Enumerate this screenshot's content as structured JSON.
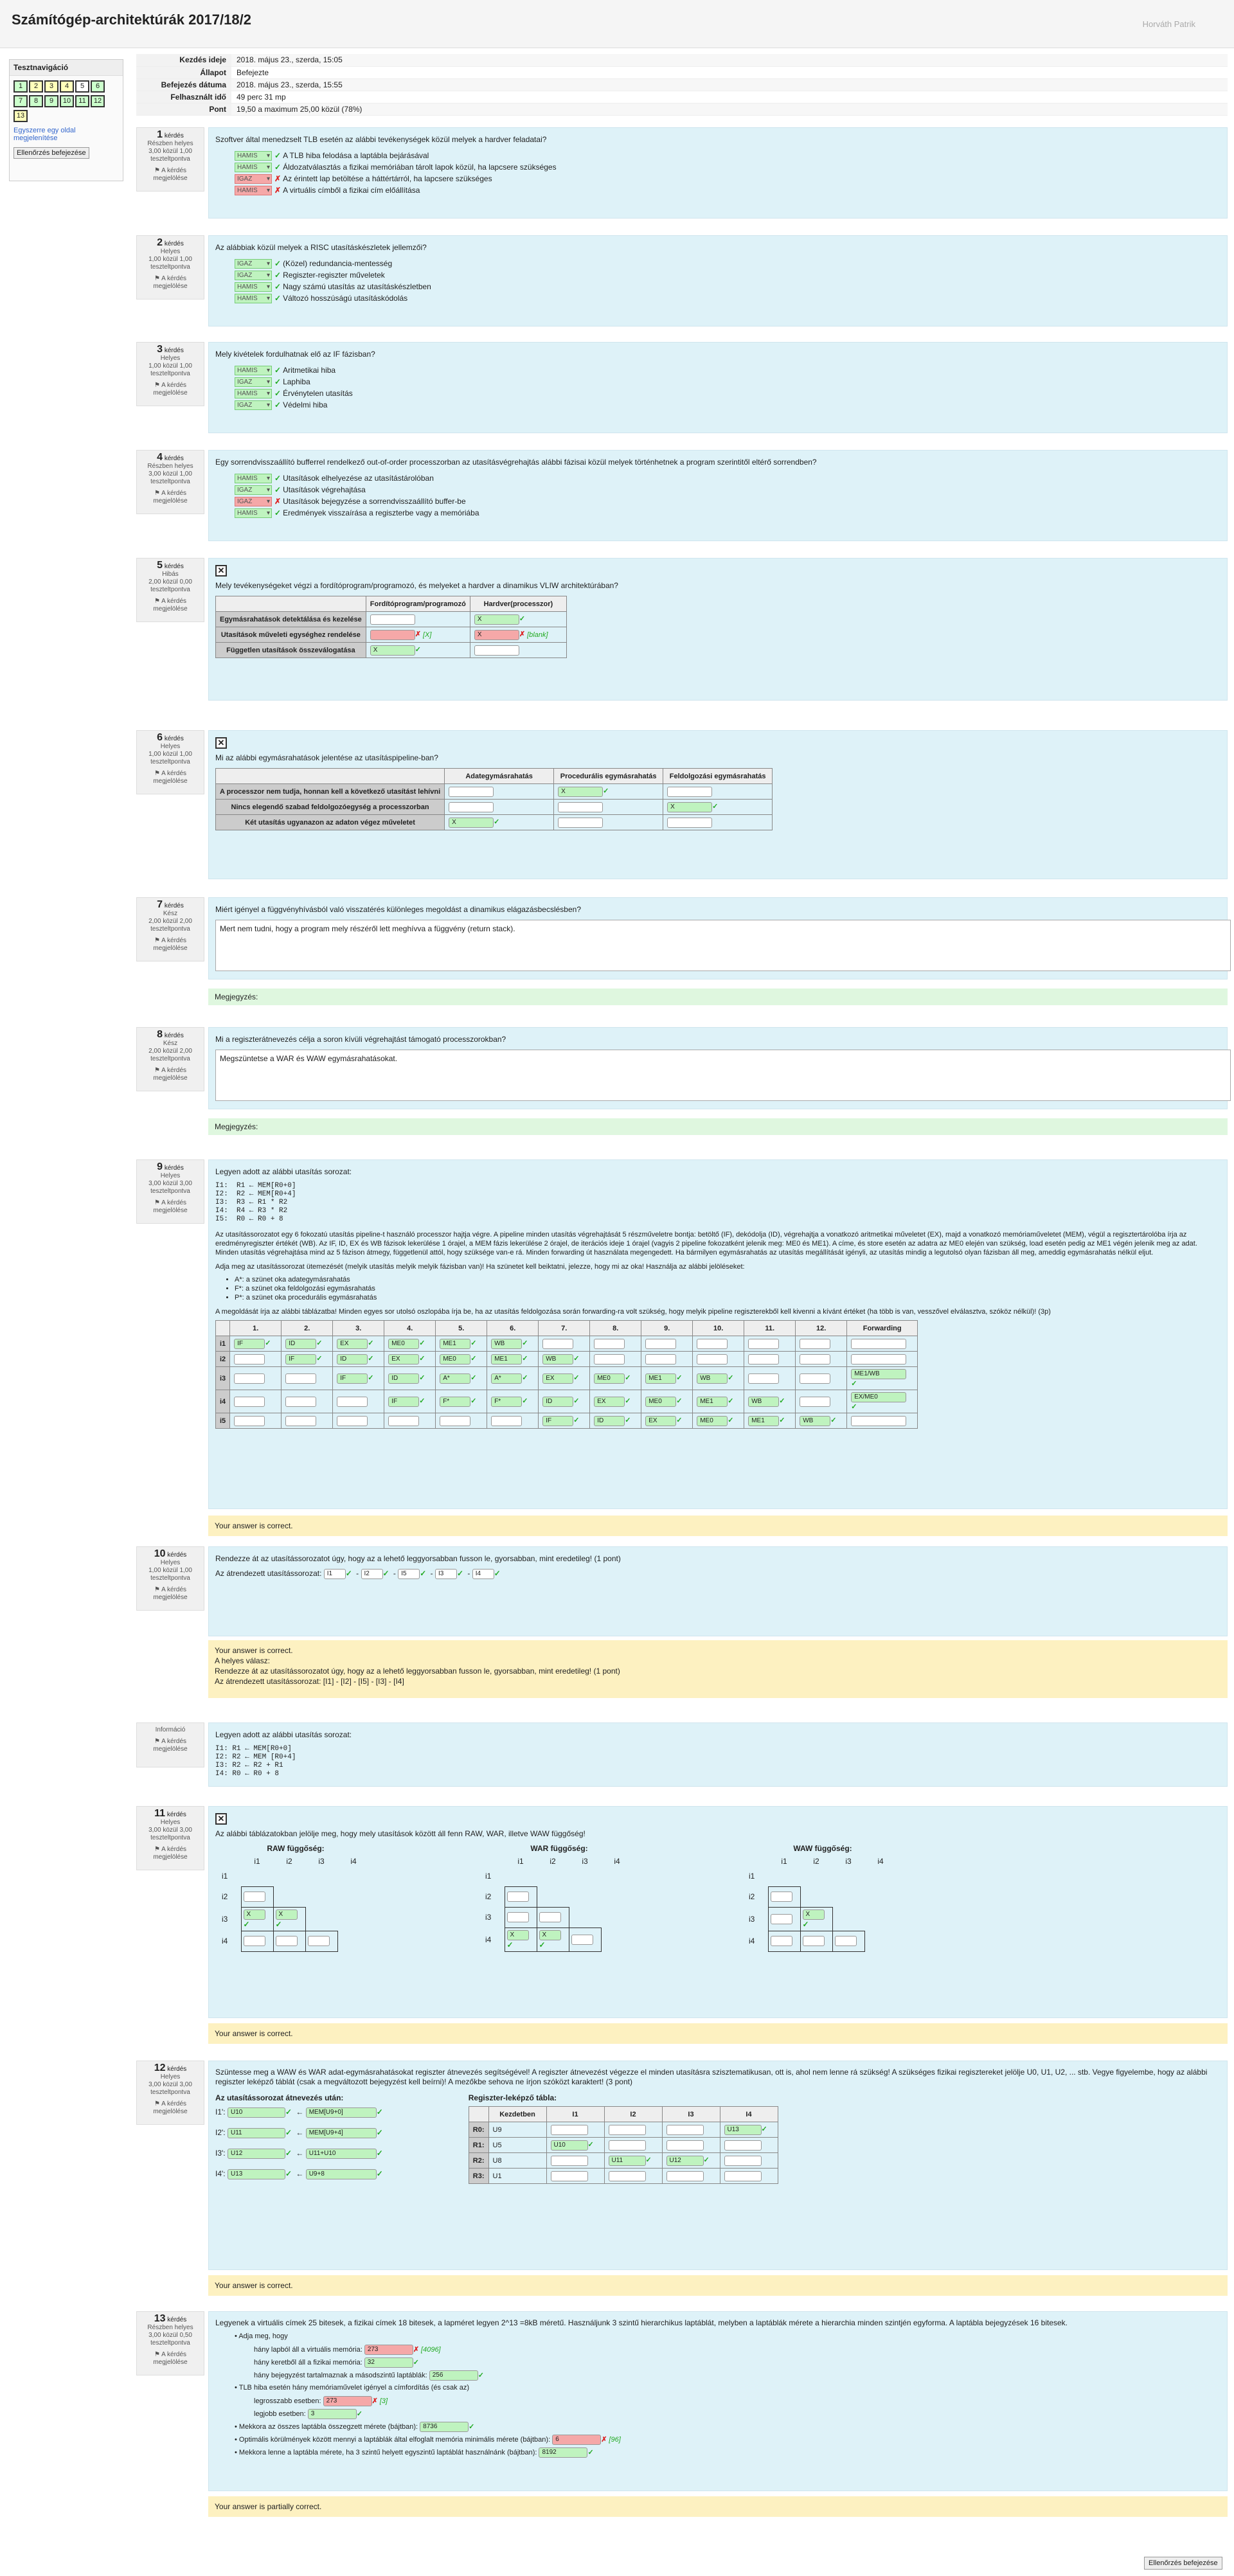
{
  "header": {
    "title": "Számítógép-architektúrák 2017/18/2",
    "user": "Horváth Patrik"
  },
  "nav": {
    "title": "Tesztnavigáció",
    "buttons": [
      "1",
      "2",
      "3",
      "4",
      "5",
      "6",
      "7",
      "8",
      "9",
      "10",
      "11",
      "12",
      "13"
    ],
    "show_one_page": "Egyszerre egy oldal megjelenítése",
    "finish_review": "Ellenőrzés befejezése"
  },
  "summary": [
    {
      "k": "Kezdés ideje",
      "v": "2018. május 23., szerda, 15:05"
    },
    {
      "k": "Állapot",
      "v": "Befejezte"
    },
    {
      "k": "Befejezés dátuma",
      "v": "2018. május 23., szerda, 15:55"
    },
    {
      "k": "Felhasznált idő",
      "v": "49 perc 31 mp"
    },
    {
      "k": "Pont",
      "v": "19,50 a maximum 25,00 közül (78%)"
    }
  ],
  "labels": {
    "q": "kérdés",
    "flag": "A kérdés megjelölése",
    "info": "Információ"
  },
  "q1": {
    "no": "1",
    "status": "Részben helyes",
    "score": "3,00 közül 1,00 teszteltpontva",
    "text": "Szoftver által menedzselt TLB esetén az alábbi tevékenységek közül melyek a hardver feladatai?",
    "items": [
      {
        "sel": "HAMIS",
        "ok": true,
        "t": "A TLB hiba felodása a laptábla bejárásával"
      },
      {
        "sel": "HAMIS",
        "ok": true,
        "t": "Áldozatválasztás a fizikai memóriában tárolt lapok közül, ha lapcsere szükséges"
      },
      {
        "sel": "IGAZ",
        "ok": false,
        "t": "Az érintett lap betöltése a háttértárról, ha lapcsere szükséges"
      },
      {
        "sel": "HAMIS",
        "ok": false,
        "t": "A virtuális címből a fizikai cím előállítása"
      }
    ]
  },
  "q2": {
    "no": "2",
    "status": "Helyes",
    "score": "1,00 közül 1,00 teszteltpontva",
    "text": "Az alábbiak közül melyek a RISC utasításkészletek jellemzői?",
    "items": [
      {
        "sel": "IGAZ",
        "t": "(Közel) redundancia-mentesség"
      },
      {
        "sel": "IGAZ",
        "t": "Regiszter-regiszter műveletek"
      },
      {
        "sel": "HAMIS",
        "t": "Nagy számú utasítás az utasításkészletben"
      },
      {
        "sel": "HAMIS",
        "t": "Változó hosszúságú utasításkódolás"
      }
    ]
  },
  "q3": {
    "no": "3",
    "status": "Helyes",
    "score": "1,00 közül 1,00 teszteltpontva",
    "text": "Mely kivételek fordulhatnak elő az IF fázisban?",
    "items": [
      {
        "sel": "HAMIS",
        "t": "Aritmetikai hiba"
      },
      {
        "sel": "IGAZ",
        "t": "Laphiba"
      },
      {
        "sel": "HAMIS",
        "t": "Érvénytelen utasítás"
      },
      {
        "sel": "IGAZ",
        "t": "Védelmi hiba"
      }
    ]
  },
  "q4": {
    "no": "4",
    "status": "Részben helyes",
    "score": "3,00 közül 1,00 teszteltpontva",
    "text": "Egy sorrendvisszaállító bufferrel rendelkező out-of-order processzorban az utasításvégrehajtás alábbi fázisai közül melyek történhetnek a program szerintitől eltérő sorrendben?",
    "items": [
      {
        "sel": "HAMIS",
        "ok": true,
        "t": "Utasítások elhelyezése az utasítástárolóban"
      },
      {
        "sel": "IGAZ",
        "ok": true,
        "t": "Utasítások végrehajtása"
      },
      {
        "sel": "IGAZ",
        "ok": false,
        "t": "Utasítások bejegyzése a sorrendvisszaállító buffer-be"
      },
      {
        "sel": "HAMIS",
        "ok": true,
        "t": "Eredmények visszaírása a regiszterbe vagy a memóriába"
      }
    ]
  },
  "q5": {
    "no": "5",
    "status": "Hibás",
    "score": "2,00 közül 0,00 teszteltpontva",
    "text": "Mely tevékenységeket végzi a fordítóprogram/programozó, és melyeket a hardver a dinamikus VLIW architektúrában?",
    "cols": [
      "Fordítóprogram/programozó",
      "Hardver(processzor)"
    ],
    "rows": [
      {
        "l": "Egymásrahatások detektálása és kezelése",
        "a": "",
        "b": "X"
      },
      {
        "l": "Utasítások műveleti egységhez rendelése",
        "a": "",
        "b": "X",
        "ca": "[X]",
        "cb": "[blank]"
      },
      {
        "l": "Független utasítások összeválogatása",
        "a": "X",
        "b": ""
      }
    ]
  },
  "q6": {
    "no": "6",
    "status": "Helyes",
    "score": "1,00 közül 1,00 teszteltpontva",
    "text": "Mi az alábbi egymásrahatások jelentése az utasításpipeline-ban?",
    "cols": [
      "Adategymásrahatás",
      "Procedurális egymásrahatás",
      "Feldolgozási egymásrahatás"
    ],
    "rows": [
      {
        "l": "A processzor nem tudja, honnan kell a következő utasítást lehívni",
        "v": [
          "",
          "X",
          ""
        ]
      },
      {
        "l": "Nincs elegendő szabad feldolgozóegység a processzorban",
        "v": [
          "",
          "",
          "X"
        ]
      },
      {
        "l": "Két utasítás ugyanazon az adaton végez műveletet",
        "v": [
          "X",
          "",
          ""
        ]
      }
    ]
  },
  "q7": {
    "no": "7",
    "status": "Kész",
    "score": "2,00 közül 2,00 teszteltpontva",
    "text": "Miért igényel a függvényhívásból való visszatérés különleges megoldást a dinamikus elágazásbecslésben?",
    "answer": "Mert nem tudni, hogy a program mely részéről lett meghívva a függvény (return stack).",
    "comment": "Megjegyzés:"
  },
  "q8": {
    "no": "8",
    "status": "Kész",
    "score": "2,00 közül 2,00 teszteltpontva",
    "text": "Mi a regiszterátnevezés célja a soron kívüli végrehajtást támogató processzorokban?",
    "answer": "Megszüntetse a WAR és WAW egymásrahatásokat.",
    "comment": "Megjegyzés:"
  },
  "q9": {
    "no": "9",
    "status": "Helyes",
    "score": "3,00 közül 3,00 teszteltpontva",
    "intro": "Legyen adott az alábbi utasítás sorozat:",
    "code": "I1:  R1 ← MEM[R0+0]\nI2:  R2 ← MEM[R0+4]\nI3:  R3 ← R1 * R2\nI4:  R4 ← R3 * R2\nI5:  R0 ← R0 + 8",
    "para1": "Az utasítássorozatot egy 6 fokozatú utasítás pipeline-t használó processzor hajtja végre. A pipeline minden utasítás végrehajtását 5 részműveletre bontja: betöltő (IF), dekódolja (ID), végrehajtja a vonatkozó aritmetikai műveletet (EX), majd a vonatkozó memóriaműveletet (MEM), végül a regisztertárolóba írja az eredményregiszter értékét (WB). Az IF, ID, EX és WB fázisok lekerülése 1 órajel, a MEM fázis lekerülése 2 órajel, de iterációs ideje 1 órajel (vagyis 2 pipeline fokozatként jelenik meg: ME0 és ME1). A címe, és store esetén az adatra az ME0 elején van szükség, load esetén pedig az ME1 végén jelenik meg az adat. Minden utasítás végrehajtása mind az 5 fázison átmegy, függetlenül attól, hogy szüksége van-e rá. Minden forwarding út használata megengedett. Ha bármilyen egymásrahatás az utasítás megállítását igényli, az utasítás mindig a legutolsó olyan fázisban áll meg, ameddig egymásrahatás nélkül eljut.",
    "para2": "Adja meg az utasítássorozat ütemezését (melyik utasítás melyik melyik fázisban van)! Ha szünetet kell beiktatni, jelezze, hogy mi az oka! Használja az alábbi jelöléseket:",
    "legend": [
      "A*: a szünet oka adategymásrahatás",
      "F*: a szünet oka feldolgozási egymásrahatás",
      "P*: a szünet oka procedurális egymásrahatás"
    ],
    "para3": "A megoldását írja az alábbi táblázatba! Minden egyes sor utolsó oszlopába írja be, ha az utasítás feldolgozása során forwarding-ra volt szükség, hogy melyik pipeline regiszterekből kell kivenni a kívánt értéket (ha több is van, vesszővel elválasztva, szóköz nélkül)! (3p)",
    "cols": [
      "1.",
      "2.",
      "3.",
      "4.",
      "5.",
      "6.",
      "7.",
      "8.",
      "9.",
      "10.",
      "11.",
      "12.",
      "Forwarding"
    ],
    "rows": [
      {
        "l": "i1",
        "v": [
          "IF",
          "ID",
          "EX",
          "ME0",
          "ME1",
          "WB",
          "",
          "",
          "",
          "",
          "",
          "",
          ""
        ]
      },
      {
        "l": "i2",
        "v": [
          "",
          "IF",
          "ID",
          "EX",
          "ME0",
          "ME1",
          "WB",
          "",
          "",
          "",
          "",
          "",
          ""
        ]
      },
      {
        "l": "i3",
        "v": [
          "",
          "",
          "IF",
          "ID",
          "A*",
          "A*",
          "EX",
          "ME0",
          "ME1",
          "WB",
          "",
          "",
          "ME1/WB"
        ]
      },
      {
        "l": "i4",
        "v": [
          "",
          "",
          "",
          "IF",
          "F*",
          "F*",
          "ID",
          "EX",
          "ME0",
          "ME1",
          "WB",
          "",
          "EX/ME0"
        ]
      },
      {
        "l": "i5",
        "v": [
          "",
          "",
          "",
          "",
          "",
          "",
          "IF",
          "ID",
          "EX",
          "ME0",
          "ME1",
          "WB",
          ""
        ]
      }
    ],
    "feedback": "Your answer is correct."
  },
  "q10": {
    "no": "10",
    "status": "Helyes",
    "score": "1,00 közül 1,00 teszteltpontva",
    "text": "Rendezze át az utasítássorozatot úgy, hogy az a lehető leggyorsabban fusson le, gyorsabban, mint eredetileg! (1 pont)",
    "label": "Az átrendezett utasítássorozat:",
    "order": [
      "I1",
      "I2",
      "I5",
      "I3",
      "I4"
    ],
    "fb1": "Your answer is correct.",
    "fb2": "A helyes válasz:",
    "fb3": "Rendezze át az utasítássorozatot úgy, hogy az a lehető leggyorsabban fusson le, gyorsabban, mint eredetileg! (1 pont)",
    "fb4": "Az átrendezett utasítássorozat: [I1] - [I2] - [I5] - [I3] - [I4]"
  },
  "info": {
    "text": "Legyen adott az alábbi utasítás sorozat:",
    "code": "I1: R1 ← MEM[R0+0]\nI2: R2 ← MEM [R0+4]\nI3: R2 ← R2 + R1\nI4: R0 ← R0 + 8"
  },
  "q11": {
    "no": "11",
    "status": "Helyes",
    "score": "3,00 közül 3,00 teszteltpontva",
    "text": "Az alábbi táblázatokban jelölje meg, hogy mely utasítások között áll fenn RAW, WAR, illetve WAW függőség!",
    "titles": [
      "RAW függőség:",
      "WAR függőség:",
      "WAW függőség:"
    ],
    "cols": [
      "i1",
      "i2",
      "i3",
      "i4"
    ],
    "feedback": "Your answer is correct."
  },
  "q12": {
    "no": "12",
    "status": "Helyes",
    "score": "3,00 közül 3,00 teszteltpontva",
    "text": "Szüntesse meg a WAW és WAR adat-egymásrahatásokat regiszter átnevezés segítségével! A regiszter átnevezést végezze el minden utasításra szisztematikusan, ott is, ahol nem lenne rá szükség! A szükséges fizikai regisztereket jelölje U0, U1, U2, ... stb. Vegye figyelembe, hogy az alábbi regiszter leképző táblát (csak a megváltozott bejegyzést kell beírni)! A mezőkbe sehova ne írjon szóközt karaktert! (3 pont)",
    "left_title": "Az utasítássorozat átnevezés után:",
    "instr": [
      {
        "l": "I1':",
        "a": "U10",
        "b": "MEM[U9+0]"
      },
      {
        "l": "I2':",
        "a": "U11",
        "b": "MEM[U9+4]"
      },
      {
        "l": "I3':",
        "a": "U12",
        "b": "U11+U10"
      },
      {
        "l": "I4':",
        "a": "U13",
        "b": "U9+8"
      }
    ],
    "right_title": "Regiszter-leképző tábla:",
    "rcols": [
      "Kezdetben",
      "I1",
      "I2",
      "I3",
      "I4"
    ],
    "rrows": [
      {
        "l": "R0:",
        "k": "U9",
        "v": [
          "",
          "",
          "",
          "U13"
        ]
      },
      {
        "l": "R1:",
        "k": "U5",
        "v": [
          "U10",
          "",
          "",
          ""
        ]
      },
      {
        "l": "R2:",
        "k": "U8",
        "v": [
          "",
          "U11",
          "U12",
          ""
        ]
      },
      {
        "l": "R3:",
        "k": "U1",
        "v": [
          "",
          "",
          "",
          ""
        ]
      }
    ],
    "feedback": "Your answer is correct."
  },
  "q13": {
    "no": "13",
    "status": "Részben helyes",
    "score": "3,00 közül 0,50 teszteltpontva",
    "text": "Legyenek a virtuális címek 25 bitesek, a fizikai címek 18 bitesek, a lapméret legyen 2^13 =8kB méretű. Használjunk 3 szintű hierarchikus laptáblát, melyben a laptáblák mérete a hierarchia minden szintjén egyforma. A laptábla bejegyzések 16 bitesek.",
    "items": [
      {
        "t": "Adja meg, hogy",
        "i": 1
      },
      {
        "t": "hány lapból áll a virtuális memória:",
        "v": "273",
        "ok": false,
        "c": "[4096]",
        "i": 2
      },
      {
        "t": "hány keretből áll a fizikai memória:",
        "v": "32",
        "ok": true,
        "i": 2
      },
      {
        "t": "hány bejegyzést tartalmaznak a másodszintű laptáblák:",
        "v": "256",
        "ok": true,
        "i": 2
      },
      {
        "t": "TLB hiba esetén hány memóriaművelet igényel a címfordítás (és csak az)",
        "i": 1
      },
      {
        "t": "legrosszabb esetben:",
        "v": "273",
        "ok": false,
        "c": "[3]",
        "i": 2
      },
      {
        "t": "legjobb esetben:",
        "v": "3",
        "ok": true,
        "i": 2
      },
      {
        "t": "Mekkora az összes laptábla összegzett mérete (bájtban):",
        "v": "8736",
        "ok": true,
        "i": 1
      },
      {
        "t": "Optimális körülmények között mennyi a laptáblák által elfoglalt memória minimális mérete (bájtban):",
        "v": "6",
        "ok": false,
        "c": "[96]",
        "i": 1
      },
      {
        "t": "Mekkora lenne a laptábla mérete, ha 3 szintű helyett egyszintű laptáblát használnánk (bájtban):",
        "v": "8192",
        "ok": true,
        "i": 1
      }
    ],
    "feedback": "Your answer is partially correct."
  },
  "finish": "Ellenőrzés befejezése"
}
